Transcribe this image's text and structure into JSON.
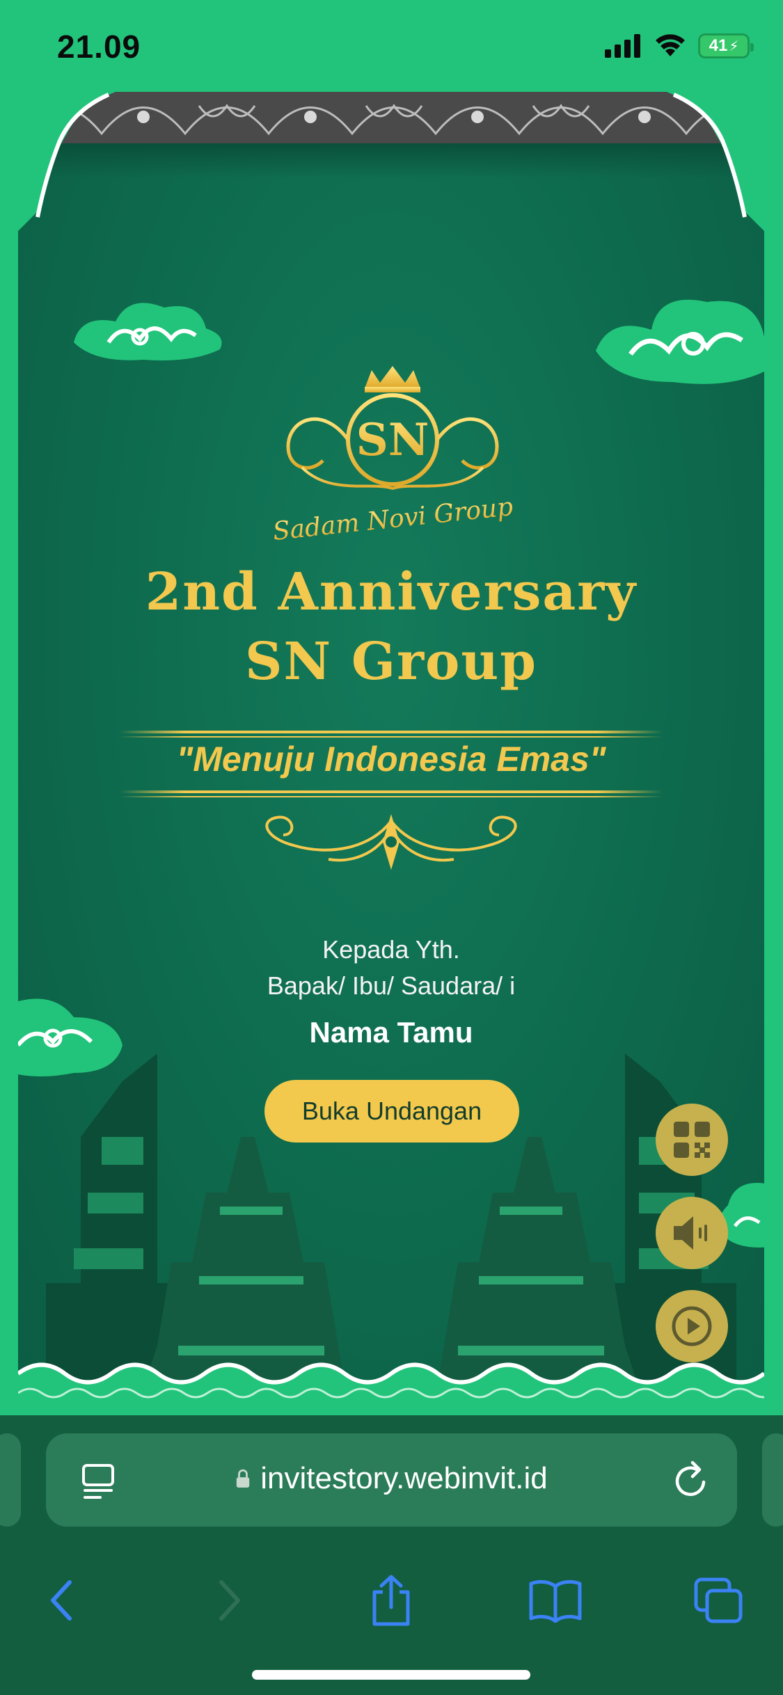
{
  "status_bar": {
    "time": "21.09",
    "battery": "41"
  },
  "card": {
    "logo_text": "Sadam Novi Group",
    "logo_monogram": "SN",
    "title_line1": "2nd Anniversary",
    "title_line2": "SN Group",
    "tagline": "\"Menuju Indonesia Emas\"",
    "to_line1": "Kepada Yth.",
    "to_line2": "Bapak/ Ibu/ Saudara/ i",
    "guest_name": "Nama Tamu",
    "open_button_label": "Buka Undangan"
  },
  "floating_buttons": [
    "qr-code-icon",
    "speaker-icon",
    "play-icon"
  ],
  "browser": {
    "url": "invitestory.webinvit.id",
    "toolbar": [
      "back-icon",
      "forward-icon",
      "share-icon",
      "bookmarks-icon",
      "tabs-icon"
    ]
  },
  "colors": {
    "status_bg": "#22c47b",
    "card_bg": "#0e6a4d",
    "gold": "#f3c84e",
    "button_bg": "#f2c94c",
    "browser_bg": "#135e3f",
    "ios_blue": "#3b82f6"
  }
}
